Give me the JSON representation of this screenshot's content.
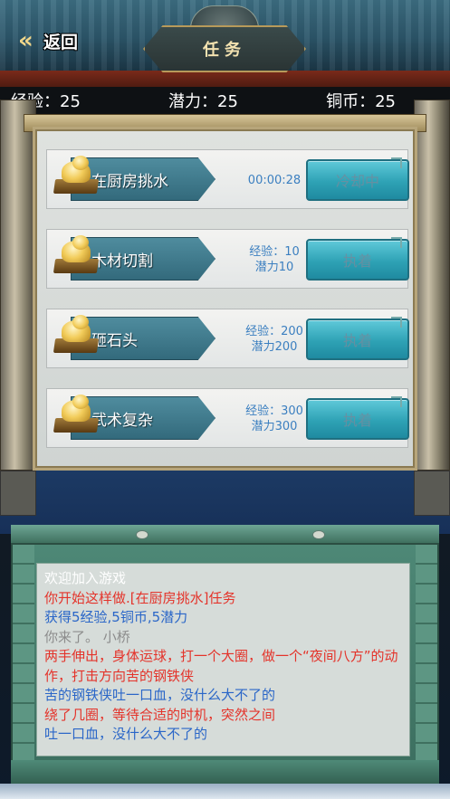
{
  "header": {
    "back_label": "返回",
    "title": "任务"
  },
  "stats": {
    "exp": "经验：25",
    "potential": "潜力：25",
    "coins": "铜币：25"
  },
  "tasks": [
    {
      "name": "在厨房挑水",
      "info_line1": "00:00:28",
      "info_line2": "",
      "action": "冷却中"
    },
    {
      "name": "木材切割",
      "info_line1": "经验：10",
      "info_line2": "潜力10",
      "action": "执着"
    },
    {
      "name": "砸石头",
      "info_line1": "经验：200",
      "info_line2": "潜力200",
      "action": "执着"
    },
    {
      "name": "武术复杂",
      "info_line1": "经验：300",
      "info_line2": "潜力300",
      "action": "执着"
    }
  ],
  "log": {
    "lines": [
      {
        "text": "欢迎加入游戏",
        "color": "#ffffff"
      },
      {
        "text": "你开始这样做.[在厨房挑水]任务",
        "color": "#e4332a"
      },
      {
        "text": "获得5经验,5铜币,5潜力",
        "color": "#2a66c8"
      },
      {
        "text": "你来了。 小桥",
        "color": "#8c8c8c"
      },
      {
        "text": "两手伸出，身体运球，打一个大圈，做一个“夜间八方”的动作，打击方向苦的钢铁侠",
        "color": "#e4332a"
      },
      {
        "text": "苦的钢铁侠吐一口血，没什么大不了的",
        "color": "#2a66c8"
      },
      {
        "text": "绕了几圈，等待合适的时机，突然之间",
        "color": "#e4332a"
      },
      {
        "text": "吐一口血，没什么大不了的",
        "color": "#2a66c8"
      }
    ]
  }
}
